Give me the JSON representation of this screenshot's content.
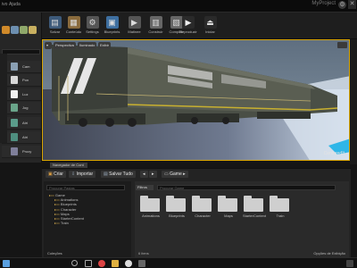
{
  "window": {
    "menu_file": "ivo",
    "menu_help": "Ajuda",
    "project_title": "MyProject",
    "close": "✕",
    "settings_icon": "⚙"
  },
  "modes": {
    "items": [
      {
        "label": "Cam",
        "icon": "camera-icon",
        "color": "#8aa0b4"
      },
      {
        "label": "Pon",
        "icon": "point-light-icon",
        "color": "#d8d8d8"
      },
      {
        "label": "Luz",
        "icon": "light-icon",
        "color": "#f0f0f0"
      },
      {
        "label": "Jog",
        "icon": "player-start-icon",
        "color": "#6aa58a"
      },
      {
        "label": "Atri",
        "icon": "trigger-icon",
        "color": "#5a9c8a"
      },
      {
        "label": "Atri",
        "icon": "trigger-sphere-icon",
        "color": "#4f8f80"
      },
      {
        "label": "Proxy",
        "icon": "blocking-volume-icon",
        "color": "#7f7f9a"
      }
    ]
  },
  "toolbar": {
    "buttons": [
      {
        "label": "Salvar",
        "icon": "save-icon",
        "color": "#3d5a7a",
        "glyph": "▤"
      },
      {
        "label": "Conteúdo",
        "icon": "content-icon",
        "color": "#8a6b3d",
        "glyph": "▦"
      },
      {
        "label": "Settings",
        "icon": "settings-icon",
        "color": "#555",
        "glyph": "⚙"
      },
      {
        "label": "Blueprints",
        "icon": "blueprints-icon",
        "color": "#3e6fa0",
        "glyph": "▣"
      },
      {
        "label": "Matinee",
        "icon": "matinee-icon",
        "color": "#555",
        "glyph": "▶"
      },
      {
        "label": "Construir",
        "icon": "build-icon",
        "color": "#666",
        "glyph": "▥"
      },
      {
        "label": "Compilar",
        "icon": "compile-icon",
        "color": "#666",
        "glyph": "▧"
      },
      {
        "label": "Reproduzir",
        "icon": "play-icon",
        "color": "#2a2a2a",
        "glyph": "▶"
      },
      {
        "label": "Iniciar",
        "icon": "launch-icon",
        "color": "#2a2a2a",
        "glyph": "⏏"
      }
    ]
  },
  "viewport": {
    "perspective_label": "Perspectiva",
    "lit_label": "Iluminado",
    "show_label": "Exibir",
    "level_name": "CenteredIt"
  },
  "content_browser": {
    "tab_label": "Navegador de Cont",
    "create_label": "Criar",
    "import_label": "Importar",
    "save_all_label": "Salvar Tudo",
    "path_label": "Game",
    "filters_label": "Filtros",
    "tree_search_placeholder": "Procurar Pastas",
    "asset_search_placeholder": "Procurar Game",
    "tree": [
      {
        "label": "Game",
        "depth": 0
      },
      {
        "label": "Animations",
        "depth": 1
      },
      {
        "label": "Blueprints",
        "depth": 1
      },
      {
        "label": "Character",
        "depth": 1
      },
      {
        "label": "Maps",
        "depth": 1
      },
      {
        "label": "StarterContent",
        "depth": 1
      },
      {
        "label": "Train",
        "depth": 1
      }
    ],
    "folders": [
      "Animations",
      "Blueprints",
      "Character",
      "Maps",
      "StarterContent",
      "Train"
    ],
    "collections_label": "Coleções",
    "item_count": "6 itens",
    "view_options": "Opções de Exibição"
  },
  "colors": {
    "accent": "#d8a400",
    "panel": "#262626",
    "background": "#151515"
  }
}
